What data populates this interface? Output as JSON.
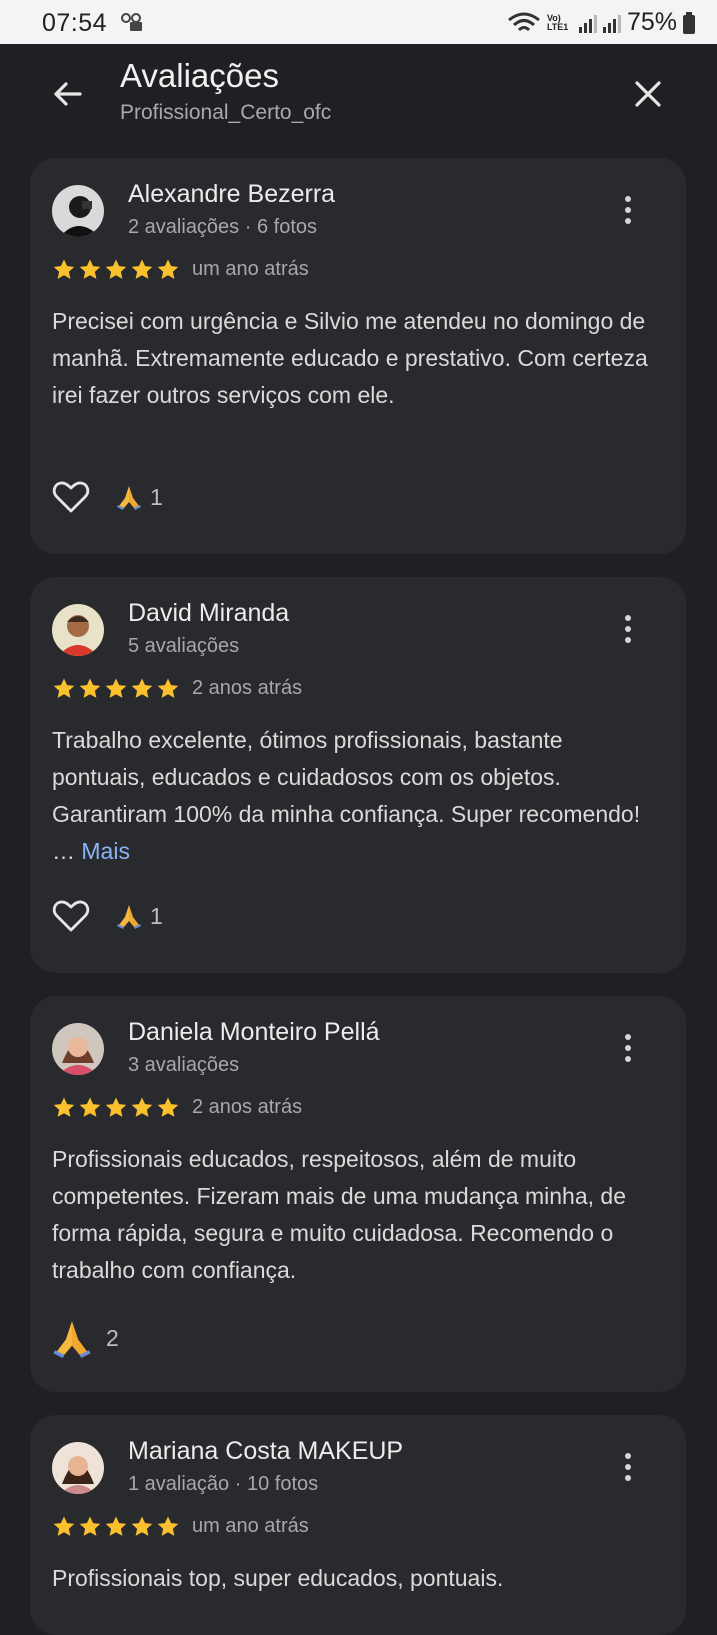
{
  "status_bar": {
    "time": "07:54",
    "network_label": "Vo) LTE1",
    "battery": "75%"
  },
  "header": {
    "title": "Avaliações",
    "subtitle": "Profissional_Certo_ofc",
    "back_icon": "arrow-back-icon",
    "close_icon": "close-icon"
  },
  "colors": {
    "background": "#1f2023",
    "card": "#292a2d",
    "star": "#fbc02d",
    "link": "#8ab4f8"
  },
  "reviews": [
    {
      "name": "Alexandre Bezerra",
      "meta": "2 avaliações · 6 fotos",
      "rating": 5,
      "date": "um ano atrás",
      "text": "Precisei com urgência e Silvio me atendeu no domingo de manhã. Extremamente educado e prestativo. Com certeza irei fazer outros serviços com ele.",
      "more_label": "",
      "pray_count": "1"
    },
    {
      "name": "David Miranda",
      "meta": "5 avaliações",
      "rating": 5,
      "date": "2 anos atrás",
      "text": "Trabalho excelente, ótimos profissionais, bastante pontuais, educados e cuidadosos com os objetos. Garantiram 100% da minha confiança. Super recomendo! … ",
      "more_label": "Mais",
      "pray_count": "1"
    },
    {
      "name": "Daniela Monteiro Pellá",
      "meta": "3 avaliações",
      "rating": 5,
      "date": "2 anos atrás",
      "text": "Profissionais educados, respeitosos, além de muito competentes. Fizeram mais de uma mudança minha, de forma rápida, segura e muito cuidadosa. Recomendo o trabalho com confiança.",
      "more_label": "",
      "pray_count": "2"
    },
    {
      "name": "Mariana Costa MAKEUP",
      "meta": "1 avaliação · 10 fotos",
      "rating": 5,
      "date": "um ano atrás",
      "text": "Profissionais top, super educados, pontuais.",
      "more_label": "",
      "pray_count": ""
    }
  ]
}
